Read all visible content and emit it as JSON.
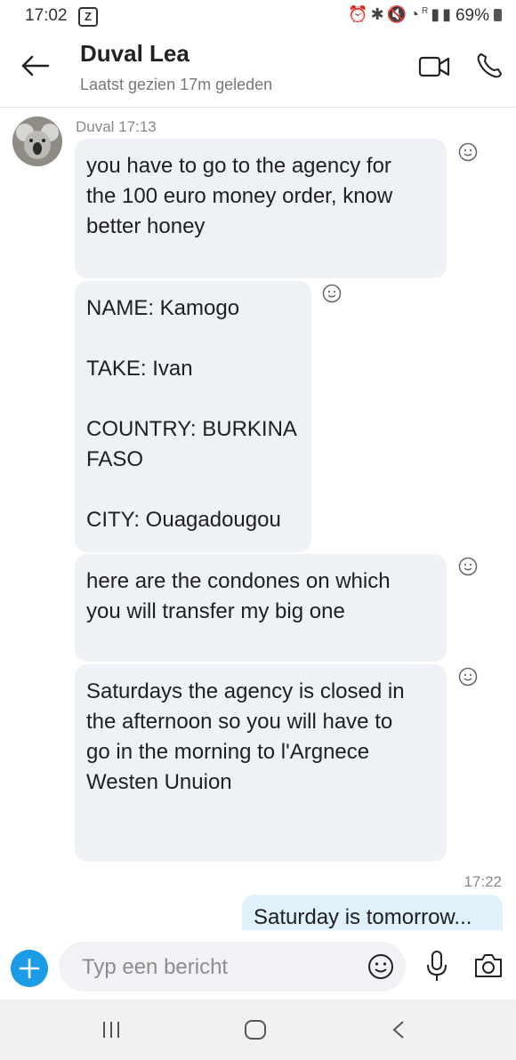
{
  "status_bar": {
    "time": "17:02",
    "app_badge": "Z",
    "battery_percent": "69%",
    "signal_label": "R"
  },
  "header": {
    "contact_name": "Duval Lea",
    "last_seen": "Laatst gezien 17m geleden"
  },
  "messages": [
    {
      "sender": "Duval",
      "time": "17:13",
      "text": "you have to go to the agency for\nthe 100 euro money order, know\nbetter honey"
    },
    {
      "text": "NAME: Kamogo\n\nTAKE: Ivan\n\nCOUNTRY: BURKINA\nFASO\n\nCITY: Ouagadougou"
    },
    {
      "text": "here are the condones on which\nyou will transfer my big one"
    },
    {
      "text": "Saturdays the agency is closed in\nthe afternoon so you will have to\ngo in the morning to l'Argnece\nWesten Unuion"
    }
  ],
  "outgoing": {
    "time": "17:22",
    "text": "Saturday is tomorrow..."
  },
  "composer": {
    "placeholder": "Typ een bericht"
  },
  "colors": {
    "incoming_bubble": "#eef2f6",
    "outgoing_bubble": "#dff2fb",
    "accent": "#1c9ce5"
  }
}
